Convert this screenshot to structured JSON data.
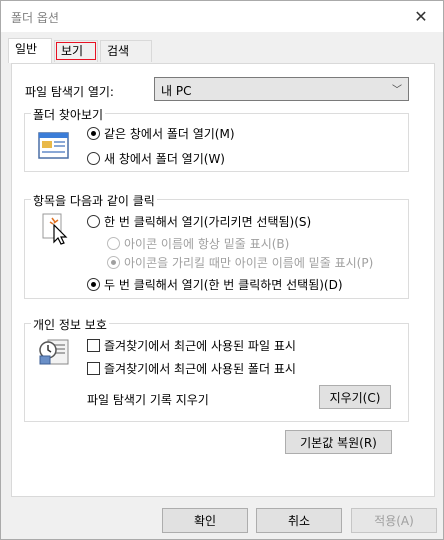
{
  "window": {
    "title": "폴더 옵션",
    "close_glyph": "✕"
  },
  "tabs": [
    {
      "label": "일반",
      "active": true
    },
    {
      "label": "보기",
      "active": false
    },
    {
      "label": "검색",
      "active": false
    }
  ],
  "explorer_open": {
    "label": "파일 탐색기 열기:",
    "value": "내 PC",
    "chevron": "﹀"
  },
  "browse_folders": {
    "title": "폴더 찾아보기",
    "icon": "folder-window-icon",
    "options": [
      {
        "label": "같은 창에서 폴더 열기(M)",
        "selected": true
      },
      {
        "label": "새 창에서 폴더 열기(W)",
        "selected": false
      }
    ]
  },
  "click_items": {
    "title": "항목을 다음과 같이 클릭",
    "icon": "cursor-click-icon",
    "options": [
      {
        "label": "한 번 클릭해서 열기(가리키면 선택됨)(S)",
        "selected": false,
        "disabled": false
      },
      {
        "label": "아이콘 이름에 항상 밑줄 표시(B)",
        "selected": false,
        "disabled": true
      },
      {
        "label": "아이콘을 가리킬 때만 아이콘 이름에 밑줄 표시(P)",
        "selected": true,
        "disabled": true
      },
      {
        "label": "두 번 클릭해서 열기(한 번 클릭하면 선택됨)(D)",
        "selected": true,
        "disabled": false
      }
    ]
  },
  "privacy": {
    "title": "개인 정보 보호",
    "icon": "privacy-icon",
    "checks": [
      {
        "label": "즐겨찾기에서 최근에 사용된 파일 표시",
        "checked": false
      },
      {
        "label": "즐겨찾기에서 최근에 사용된 폴더 표시",
        "checked": false
      }
    ],
    "clear_label": "파일 탐색기 기록 지우기",
    "clear_button": "지우기(C)"
  },
  "restore_defaults": "기본값 복원(R)",
  "footer": {
    "ok": "확인",
    "cancel": "취소",
    "apply": "적용(A)"
  }
}
